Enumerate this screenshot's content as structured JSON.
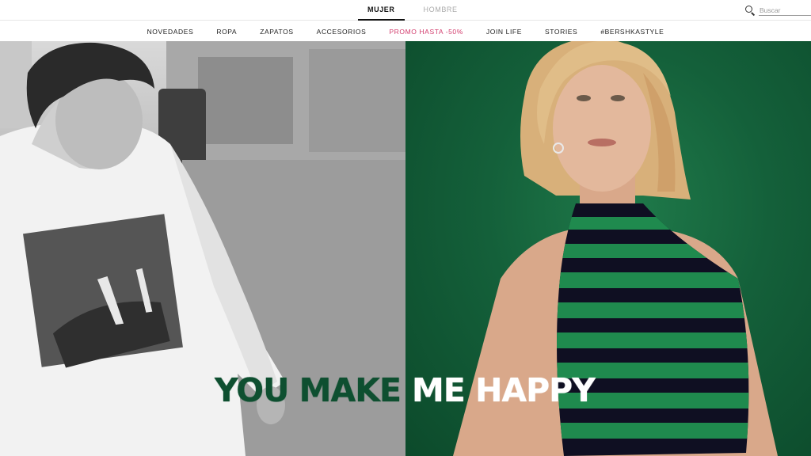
{
  "header": {
    "gender_tabs": [
      {
        "label": "MUJER",
        "active": true
      },
      {
        "label": "HOMBRE",
        "active": false
      }
    ],
    "search": {
      "placeholder": "Buscar",
      "icon": "search-icon"
    }
  },
  "nav": {
    "items": [
      {
        "label": "NOVEDADES"
      },
      {
        "label": "ROPA"
      },
      {
        "label": "ZAPATOS"
      },
      {
        "label": "ACCESORIOS"
      },
      {
        "label": "PROMO HASTA -50%",
        "color": "#d23c6d"
      },
      {
        "label": "JOIN LIFE"
      },
      {
        "label": "STORIES"
      },
      {
        "label": "#BERSHKASTYLE"
      }
    ]
  },
  "hero": {
    "headline_left": "YOU MAKE",
    "headline_right": "ME HAPPY",
    "colors": {
      "green": "#14603a",
      "headline_green": "#0e4f30"
    }
  }
}
